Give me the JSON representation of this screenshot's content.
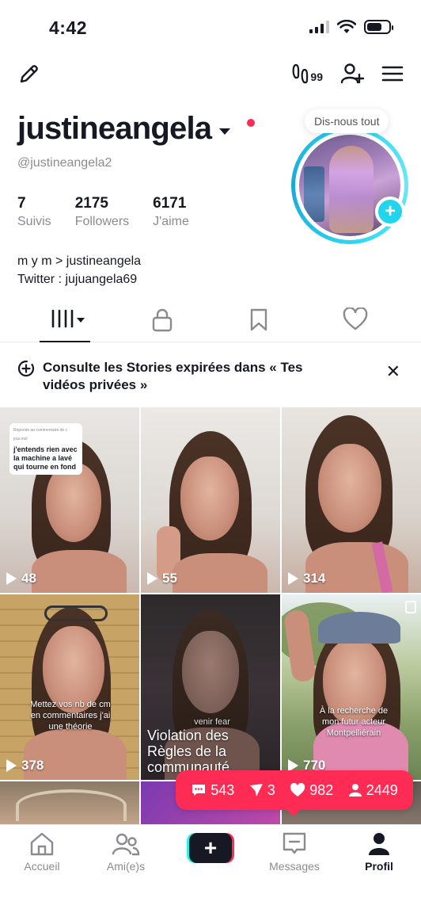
{
  "status_bar": {
    "time": "4:42"
  },
  "profile": {
    "username": "justineangela",
    "handle": "@justineangela2",
    "tooltip": "Dis-nous tout",
    "stats": [
      {
        "value": "7",
        "label": "Suivis"
      },
      {
        "value": "2175",
        "label": "Followers"
      },
      {
        "value": "6171",
        "label": "J'aime"
      }
    ],
    "bio_line1": "m y m > justineangela",
    "bio_line2": "Twitter : jujuangela69"
  },
  "topbar": {
    "views_icon_label": "99"
  },
  "tabs": [
    "videos-grid",
    "private",
    "saved",
    "liked"
  ],
  "banner": {
    "text": "Consulte les Stories expirées dans « Tes vidéos privées »",
    "close": "✕"
  },
  "videos": [
    {
      "count": "48",
      "reply_header": "Réponds au commentaire de c jour.mol",
      "reply_text": "j'entends rien avec la machine a lavé qui tourne en fond"
    },
    {
      "count": "55"
    },
    {
      "count": "314"
    },
    {
      "count": "378",
      "caption": "Mettez vos nb de cm en commentaires j'ai une théorie"
    },
    {
      "violation": "Violation des Règles de la communauté",
      "overlay_text": "venir fear"
    },
    {
      "count": "770",
      "caption": "À la recherche de mon futur acteur Montpelliérain"
    }
  ],
  "pill_stats": {
    "comments": "543",
    "shares": "3",
    "likes": "982",
    "followers": "2449"
  },
  "nav": {
    "home": "Accueil",
    "friends": "Ami(e)s",
    "create": "+",
    "messages": "Messages",
    "profile": "Profil"
  },
  "colors": {
    "accent_red": "#fe2c55",
    "accent_cyan": "#25f4ee",
    "text": "#161823",
    "muted": "#8a8b91"
  }
}
